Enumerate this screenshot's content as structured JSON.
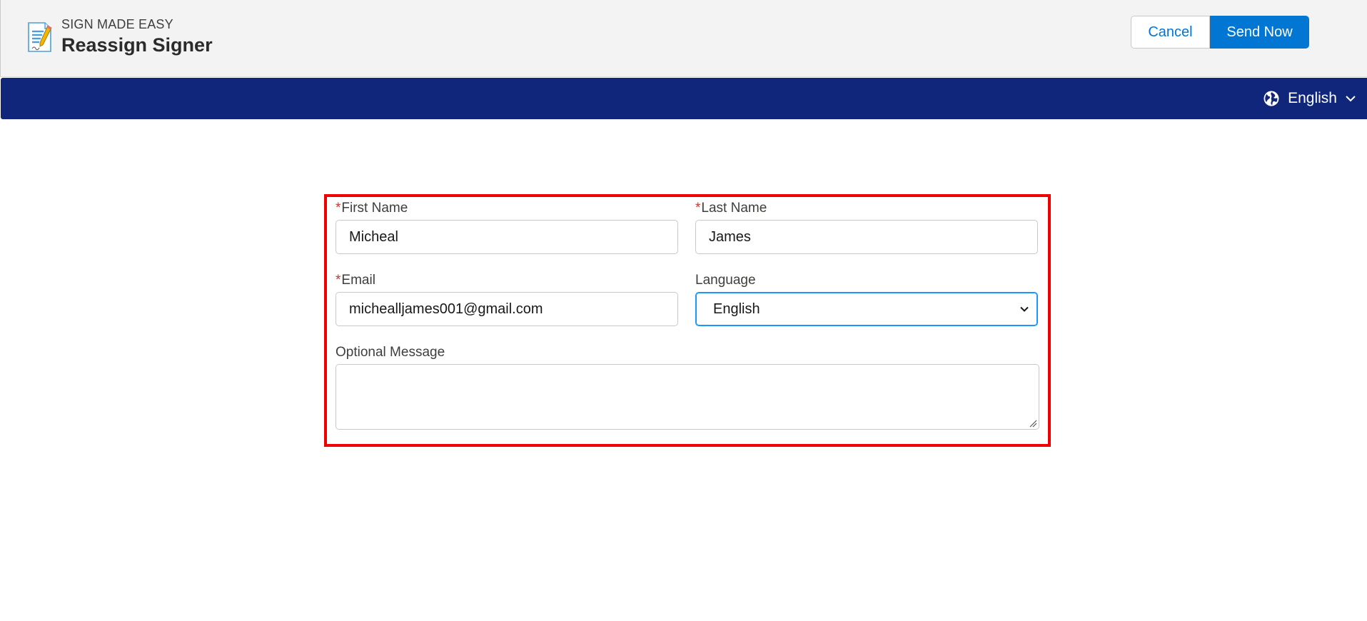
{
  "header": {
    "app_name": "SIGN MADE EASY",
    "title": "Reassign Signer",
    "icon": "document-pen-icon",
    "cancel_label": "Cancel",
    "send_label": "Send Now"
  },
  "navbar": {
    "language_label": "English",
    "icons": [
      "globe-icon",
      "chevron-down-icon"
    ]
  },
  "form": {
    "first_name": {
      "label": "First Name",
      "required_mark": "*",
      "value": "Micheal"
    },
    "last_name": {
      "label": "Last Name",
      "required_mark": "*",
      "value": "James"
    },
    "email": {
      "label": "Email",
      "required_mark": "*",
      "value": "michealljames001@gmail.com"
    },
    "language": {
      "label": "Language",
      "value": "English"
    },
    "message": {
      "label": "Optional Message",
      "value": ""
    }
  },
  "colors": {
    "brand_blue": "#0176d3",
    "navbar": "#10267a",
    "highlight_border": "#f00000",
    "required": "#c23934"
  }
}
